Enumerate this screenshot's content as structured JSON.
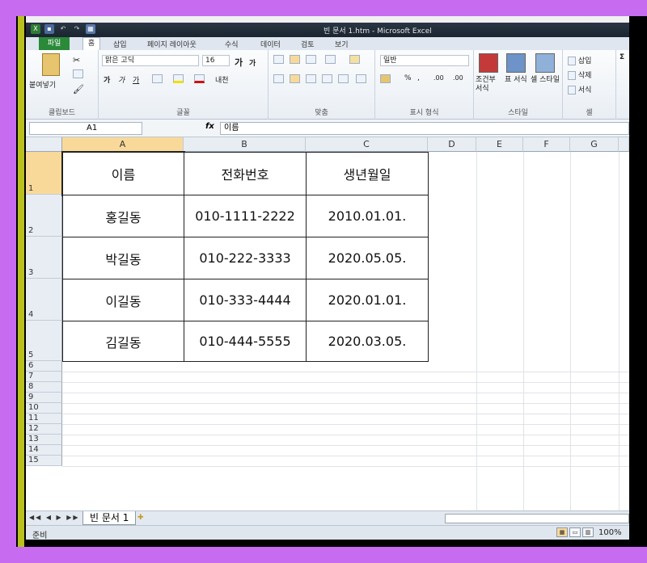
{
  "window": {
    "title": "빈 문서 1.htm - Microsoft Excel"
  },
  "quick_access": {
    "icons": [
      "excel-icon",
      "save-icon",
      "undo-icon",
      "redo-icon",
      "custom-icon"
    ]
  },
  "tabs": {
    "file": "파일",
    "items": [
      "홈",
      "삽입",
      "페이지 레이아웃",
      "수식",
      "데이터",
      "검토",
      "보기"
    ]
  },
  "ribbon": {
    "clipboard": {
      "label": "클립보드",
      "paste": "붙여넣기"
    },
    "font": {
      "label": "글꼴",
      "name": "맑은 고딕",
      "size": "16",
      "grow": "가",
      "shrink": "가",
      "bold": "가",
      "italic": "가",
      "underline": "가",
      "phonetic": "내천"
    },
    "alignment": {
      "label": "맞춤"
    },
    "number": {
      "label": "표시 형식",
      "format": "일반",
      "percent": "%",
      "comma": ",",
      "inc_decimal": ".00",
      "dec_decimal": ".00"
    },
    "styles": {
      "label": "스타일",
      "conditional": "조건부 서식",
      "table": "표 서식",
      "cell": "셀 스타일"
    },
    "cells": {
      "label": "셀",
      "insert": "삽입",
      "delete": "삭제",
      "format": "서식"
    },
    "sigma": "Σ"
  },
  "formula_bar": {
    "name_box": "A1",
    "fx": "fx",
    "value": "이름"
  },
  "columns": [
    "A",
    "B",
    "C",
    "D",
    "E",
    "F",
    "G"
  ],
  "rows": [
    "1",
    "2",
    "3",
    "4",
    "5",
    "6",
    "7",
    "8",
    "9",
    "10",
    "11",
    "12",
    "13",
    "14",
    "15"
  ],
  "table": [
    [
      "이름",
      "전화번호",
      "생년월일"
    ],
    [
      "홍길동",
      "010-1111-2222",
      "2010.01.01."
    ],
    [
      "박길동",
      "010-222-3333",
      "2020.05.05."
    ],
    [
      "이길동",
      "010-333-4444",
      "2020.01.01."
    ],
    [
      "김길동",
      "010-444-5555",
      "2020.03.05."
    ]
  ],
  "sheet_tabs": {
    "nav": "◀◀ ◀ ▶ ▶▶",
    "active": "빈 문서 1"
  },
  "status": {
    "ready": "준비",
    "zoom": "100%"
  }
}
